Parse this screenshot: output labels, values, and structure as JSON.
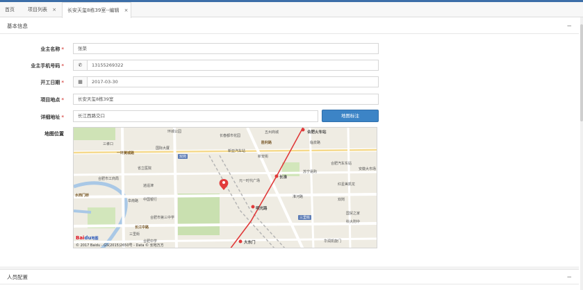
{
  "tabs": [
    {
      "label": "首页",
      "closable": false
    },
    {
      "label": "项目列表",
      "closable": true
    },
    {
      "label": "长安天玺8栋39室--编辑",
      "closable": true,
      "active": true
    }
  ],
  "close_glyph": "×",
  "panels": {
    "basic": {
      "title": "基本信息",
      "collapse": "−"
    },
    "staff": {
      "title": "人员配置",
      "collapse": "−"
    }
  },
  "form": {
    "owner_name": {
      "label": "业主名称",
      "required": "*",
      "value": "张菜"
    },
    "owner_phone": {
      "label": "业主手机号码",
      "required": "*",
      "value": "13155269322",
      "icon": "phone-icon"
    },
    "start_date": {
      "label": "开工日期",
      "required": "*",
      "value": "2017-03-30",
      "icon": "calendar-icon"
    },
    "project_location": {
      "label": "项目地点",
      "required": "*",
      "value": "长安天玺8栋39室"
    },
    "detail_address": {
      "label": "详细地址",
      "required": "*",
      "value": "长江西路交口"
    },
    "map_position": {
      "label": "地图位置"
    }
  },
  "map_button": {
    "label": "地图标注"
  },
  "map": {
    "labels": {
      "l1": "环城公园",
      "l2": "三孝口",
      "l3": "一环黄城路",
      "l4": "国际大厦",
      "l5": "长春都市花园",
      "l6": "新亚汽车站",
      "l7": "新安街",
      "l8": "五州商城",
      "l9": "合肥火车站",
      "l10": "胜利路",
      "l11": "临泉路",
      "l12": "长淮",
      "l13": "元一时代广场",
      "l14": "明光路",
      "l15": "阜南路",
      "l16": "水西门桥",
      "l17": "合肥市第三中学",
      "l18": "大东门",
      "l19": "三里街",
      "l20": "国贸之家",
      "l21": "合肥市工商局",
      "l22": "省立医院",
      "l23": "逍遥津",
      "l24": "安徽大市场",
      "l25": "合肥汽车东站",
      "l26": "华润凯旋门",
      "l27": "长江中路",
      "l28": "双岗",
      "l29": "中国银行",
      "l30": "红星美凯龙",
      "l31": "淮河路",
      "l32": "合肥中学",
      "l33": "苏宁易购",
      "l34": "科大附中"
    },
    "badge_metro": "双岗",
    "badge_metro2": "三里街",
    "logo_text": "Bai",
    "logo_paw": "du",
    "logo_suffix": "地图",
    "copyright": "© 2017 Baidu - GS(2015)2650号 - Data © 长地万方",
    "marker_color": "#e23b3b"
  },
  "colors": {
    "accent": "#3c6ea8",
    "required": "#d9534f",
    "button": "#3c84c6"
  }
}
